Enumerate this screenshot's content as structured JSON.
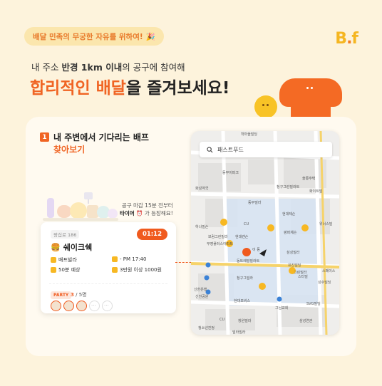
{
  "header": {
    "pill_text": "배달 민족의 무궁한 자유를 위하여!",
    "pill_emoji": "🎉",
    "logo_b": "B",
    "logo_dot": ".",
    "logo_f": "f"
  },
  "intro": {
    "sub_prefix": "내 주소 ",
    "sub_bold": "반경 1km 이내",
    "sub_suffix": "의 공구에 참여해",
    "headline_highlight": "합리적인 배달",
    "headline_rest": "을 즐겨보세요!"
  },
  "step": {
    "number": "1",
    "title_line1": "내 주변에서 기다리는 배프",
    "title_line2": "찾아보기"
  },
  "note": {
    "line1": "공구 마감 15분 전부터",
    "line2_bold": "타이머",
    "line2_emoji": "⏰",
    "line2_rest": "가 등장해요!"
  },
  "order": {
    "address_tag": "왕십로 186",
    "timer": "01:12",
    "store_icon": "🍔",
    "store_name": "쉐이크쉑",
    "place": "배프빌라",
    "time": "- PM 17:40",
    "fee": "50분 예상",
    "min_order": "3만원 이상 1000원",
    "party_tag": "PARTY",
    "party_current": "3",
    "party_total": "/ 5명"
  },
  "map": {
    "search_placeholder": "패스트푸드",
    "labels": [
      "학마을빌딩",
      "동부이파크",
      "화성약국",
      "솔롱주택",
      "청구그린빌라트",
      "화이트빌",
      "동부빌라",
      "현대제슨",
      "하나빌슨",
      "보람그린빌라",
      "현대캔슨",
      "팡퍼체슨",
      "위너스빌",
      "부영플러스아파트",
      "삼성빌라",
      "이 동",
      "동트레빌빌라트",
      "청구그빌라",
      "유진빌딩",
      "그린빌라",
      "스페이스",
      "스타빌",
      "성수빌딩",
      "신한은행",
      "현대모비스",
      "그님교회",
      "SVG빌딩",
      "삼성연관",
      "청소년진정",
      "신천공원",
      "창원빌라",
      "CU",
      "CU",
      "빌라빌라"
    ]
  }
}
